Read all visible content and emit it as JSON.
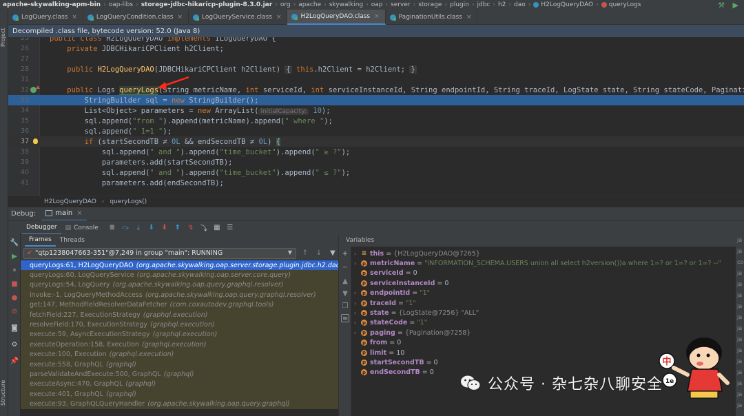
{
  "breadcrumb": {
    "items": [
      "apache-skywalking-apm-bin",
      "oap-libs",
      "storage-jdbc-hikaricp-plugin-8.3.0.jar",
      "org",
      "apache",
      "skywalking",
      "oap",
      "server",
      "storage",
      "plugin",
      "jdbc",
      "h2",
      "dao",
      "H2LogQueryDAO",
      "queryLogs"
    ]
  },
  "left_strip": {
    "top_label": "Project",
    "bottom_label": "Structure"
  },
  "tabs": [
    {
      "label": "LogQuery.class",
      "active": false
    },
    {
      "label": "LogQueryCondition.class",
      "active": false
    },
    {
      "label": "LogQueryService.class",
      "active": false
    },
    {
      "label": "H2LogQueryDAO.class",
      "active": true
    },
    {
      "label": "PaginationUtils.class",
      "active": false
    }
  ],
  "banner": {
    "text": "Decompiled .class file, bytecode version: 52.0 (Java 8)"
  },
  "code": {
    "lines": [
      {
        "n": "25",
        "text": "public class H2LogQueryDAO implements ILogQueryDAO {"
      },
      {
        "n": "26",
        "text": "    private JDBCHikariCPClient h2Client;"
      },
      {
        "n": "27",
        "text": ""
      },
      {
        "n": "28",
        "text": "    public H2LogQueryDAO(JDBCHikariCPClient h2Client) { this.h2Client = h2Client; }"
      },
      {
        "n": "31",
        "text": ""
      },
      {
        "n": "32",
        "text": "    public Logs queryLogs(String metricName, int serviceId, int serviceInstanceId, String endpointId, String traceId, LogState state, String stateCode, Pagination paging, int f"
      },
      {
        "n": "33",
        "text": "        StringBuilder sql = new StringBuilder();"
      },
      {
        "n": "34",
        "text": "        List<Object> parameters = new ArrayList( initialCapacity: 10);"
      },
      {
        "n": "35",
        "text": "        sql.append(\"from \").append(metricName).append(\" where \");"
      },
      {
        "n": "36",
        "text": "        sql.append(\" 1=1 \");"
      },
      {
        "n": "37",
        "text": "        if (startSecondTB ≠ 0L && endSecondTB ≠ 0L) {"
      },
      {
        "n": "38",
        "text": "            sql.append(\" and \").append(\"time_bucket\").append(\" ≥ ?\");"
      },
      {
        "n": "39",
        "text": "            parameters.add(startSecondTB);"
      },
      {
        "n": "40",
        "text": "            sql.append(\" and \").append(\"time_bucket\").append(\" ≤ ?\");"
      },
      {
        "n": "41",
        "text": "            parameters.add(endSecondTB);"
      }
    ]
  },
  "editor_crumbs": [
    "H2LogQueryDAO",
    "queryLogs()"
  ],
  "debug": {
    "title": "Debug:",
    "session": "main",
    "tabs": [
      "Debugger",
      "Console"
    ],
    "frames_tabs": [
      "Frames",
      "Threads"
    ],
    "variables_label": "Variables",
    "thread": "\"qtp1238047663-351\"@7,249 in group \"main\": RUNNING",
    "frames": [
      {
        "method": "queryLogs:61, H2LogQueryDAO",
        "pkg": "(org.apache.skywalking.oap.server.storage.plugin.jdbc.h2.dao)"
      },
      {
        "method": "queryLogs:60, LogQueryService",
        "pkg": "(org.apache.skywalking.oap.server.core.query)"
      },
      {
        "method": "queryLogs:54, LogQuery",
        "pkg": "(org.apache.skywalking.oap.query.graphql.resolver)"
      },
      {
        "method": "invoke:-1, LogQueryMethodAccess",
        "pkg": "(org.apache.skywalking.oap.query.graphql.resolver)"
      },
      {
        "method": "get:147, MethodFieldResolverDataFetcher",
        "pkg": "(com.coxautodev.graphql.tools)"
      },
      {
        "method": "fetchField:227, ExecutionStrategy",
        "pkg": "(graphql.execution)"
      },
      {
        "method": "resolveField:170, ExecutionStrategy",
        "pkg": "(graphql.execution)"
      },
      {
        "method": "execute:59, AsyncExecutionStrategy",
        "pkg": "(graphql.execution)"
      },
      {
        "method": "executeOperation:158, Execution",
        "pkg": "(graphql.execution)"
      },
      {
        "method": "execute:100, Execution",
        "pkg": "(graphql.execution)"
      },
      {
        "method": "execute:558, GraphQL",
        "pkg": "(graphql)"
      },
      {
        "method": "parseValidateAndExecute:500, GraphQL",
        "pkg": "(graphql)"
      },
      {
        "method": "executeAsync:470, GraphQL",
        "pkg": "(graphql)"
      },
      {
        "method": "execute:401, GraphQL",
        "pkg": "(graphql)"
      },
      {
        "method": "execute:93, GraphQLQueryHandler",
        "pkg": "(org.apache.skywalking.oap.query.graphql)"
      }
    ],
    "variables": [
      {
        "name": "this",
        "value": "{H2LogQueryDAO@7265}",
        "kind": "type",
        "expandable": true,
        "icon": "this"
      },
      {
        "name": "metricName",
        "value": "\"INFORMATION_SCHEMA.USERS union all select h2version())a where 1=? or 1=? or 1=? --\"",
        "kind": "str",
        "expandable": true,
        "icon": "p"
      },
      {
        "name": "serviceId",
        "value": "0",
        "kind": "num",
        "expandable": false,
        "icon": "p"
      },
      {
        "name": "serviceInstanceId",
        "value": "0",
        "kind": "num",
        "expandable": false,
        "icon": "p"
      },
      {
        "name": "endpointId",
        "value": "\"1\"",
        "kind": "str",
        "expandable": true,
        "icon": "p"
      },
      {
        "name": "traceId",
        "value": "\"1\"",
        "kind": "str",
        "expandable": true,
        "icon": "p"
      },
      {
        "name": "state",
        "value": "{LogState@7256} \"ALL\"",
        "kind": "type",
        "expandable": true,
        "icon": "p"
      },
      {
        "name": "stateCode",
        "value": "\"1\"",
        "kind": "str",
        "expandable": true,
        "icon": "p"
      },
      {
        "name": "paging",
        "value": "{Pagination@7258}",
        "kind": "type",
        "expandable": true,
        "icon": "p"
      },
      {
        "name": "from",
        "value": "0",
        "kind": "num",
        "expandable": false,
        "icon": "p"
      },
      {
        "name": "limit",
        "value": "10",
        "kind": "num",
        "expandable": false,
        "icon": "p"
      },
      {
        "name": "startSecondTB",
        "value": "0",
        "kind": "num",
        "expandable": false,
        "icon": "p"
      },
      {
        "name": "endSecondTB",
        "value": "0",
        "kind": "num",
        "expandable": false,
        "icon": "p"
      }
    ]
  },
  "right_strip": [
    "ja",
    "ja",
    "co",
    "ja",
    "ja",
    "ja",
    "ja",
    "ja",
    "ja",
    "ja",
    "ja",
    "ja",
    "ja",
    "ja",
    "ja",
    "ja"
  ],
  "watermark": {
    "text": "公众号 · 杂七杂八聊安全"
  },
  "mascot": {
    "sign": "中",
    "sign2": "1e"
  },
  "colors": {
    "accent": "#4a88c7",
    "exec_line": "#2d6099",
    "selected_frame": "#2f65ca",
    "annotation": "#ff2a1a"
  }
}
